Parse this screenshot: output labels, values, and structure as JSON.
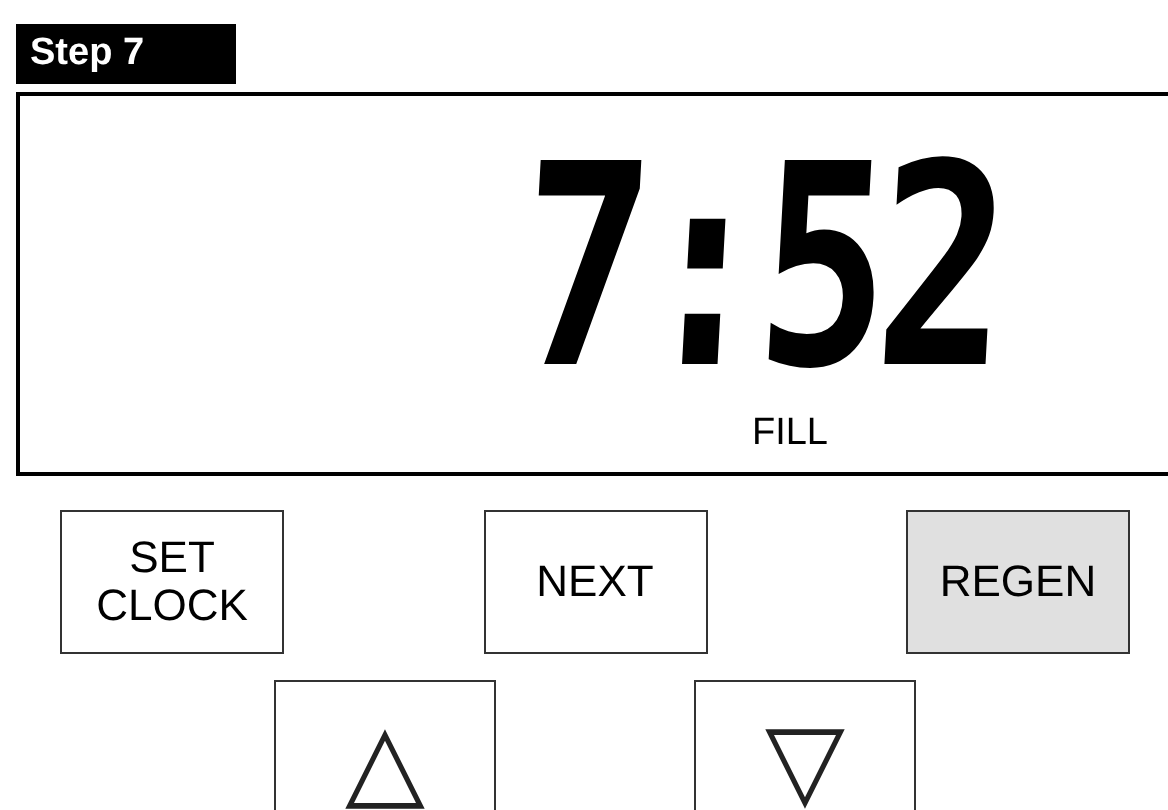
{
  "step_label": "Step 7",
  "display": {
    "time": "7:52",
    "status": "FILL"
  },
  "buttons": [
    {
      "label": "SET CLOCK",
      "active": false
    },
    {
      "label": "NEXT",
      "active": false
    },
    {
      "label": "REGEN",
      "active": true
    }
  ],
  "arrow_buttons": [
    {
      "label": "△"
    },
    {
      "label": "▽"
    }
  ]
}
